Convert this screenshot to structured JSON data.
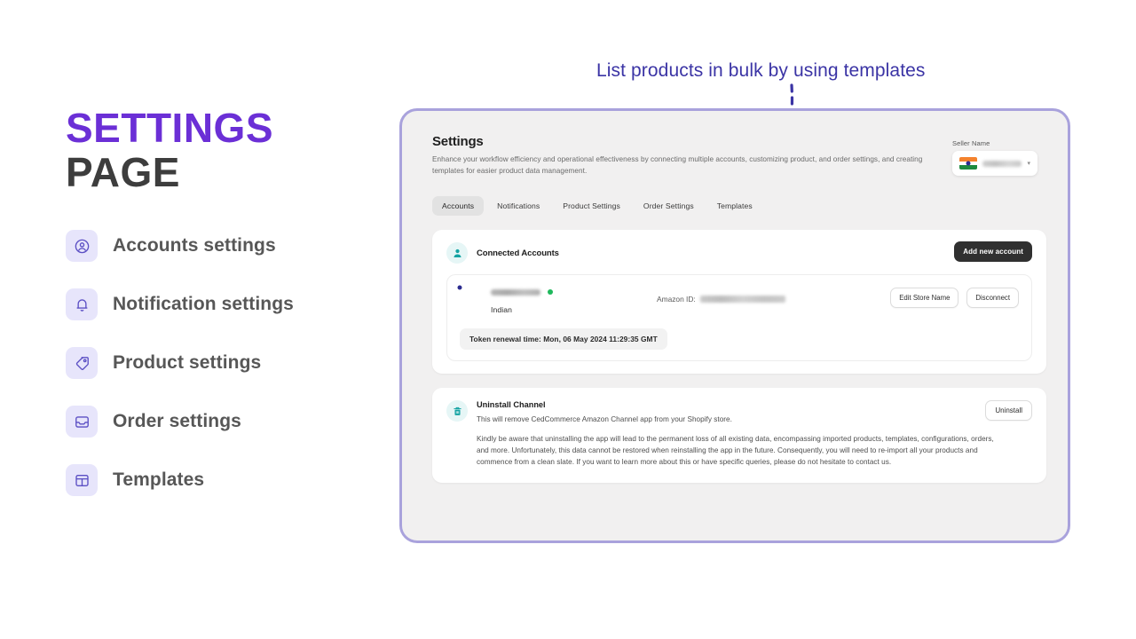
{
  "left": {
    "title_line1": "SETTINGS",
    "title_line2": "PAGE",
    "items": [
      {
        "label": "Accounts settings",
        "icon": "user-circle-icon"
      },
      {
        "label": "Notification settings",
        "icon": "bell-icon"
      },
      {
        "label": "Product settings",
        "icon": "tag-icon"
      },
      {
        "label": "Order settings",
        "icon": "inbox-icon"
      },
      {
        "label": "Templates",
        "icon": "template-icon"
      }
    ]
  },
  "annotation": {
    "text": "List products in bulk by using templates",
    "color": "#3b34a5"
  },
  "screenshot": {
    "border_color": "#a9a2dc",
    "header": {
      "title": "Settings",
      "subtitle": "Enhance your workflow efficiency and operational effectiveness by connecting multiple accounts, customizing product, and order settings, and creating templates for easier product data management."
    },
    "seller": {
      "label": "Seller Name",
      "name": "",
      "caret": "▾"
    },
    "tabs": [
      {
        "label": "Accounts",
        "active": true
      },
      {
        "label": "Notifications",
        "active": false
      },
      {
        "label": "Product Settings",
        "active": false
      },
      {
        "label": "Order Settings",
        "active": false
      },
      {
        "label": "Templates",
        "active": false
      }
    ],
    "connected_accounts": {
      "title": "Connected Accounts",
      "add_button": "Add new account",
      "account": {
        "name": "",
        "country": "Indian",
        "amazon_id_label": "Amazon ID:",
        "amazon_id_value": "",
        "status": "online",
        "edit_button": "Edit Store Name",
        "disconnect_button": "Disconnect",
        "token_chip": "Token renewal time: Mon, 06 May 2024 11:29:35 GMT"
      }
    },
    "uninstall": {
      "title": "Uninstall Channel",
      "button": "Uninstall",
      "paragraph1": "This will remove CedCommerce Amazon Channel app from your Shopify store.",
      "paragraph2": "Kindly be aware that uninstalling the app will lead to the permanent loss of all existing data, encompassing imported products, templates, configurations, orders, and more. Unfortunately, this data cannot be restored when reinstalling the app in the future. Consequently, you will need to re-import all your products and commence from a clean slate. If you want to learn more about this or have specific queries, please do not hesitate to contact us."
    }
  }
}
